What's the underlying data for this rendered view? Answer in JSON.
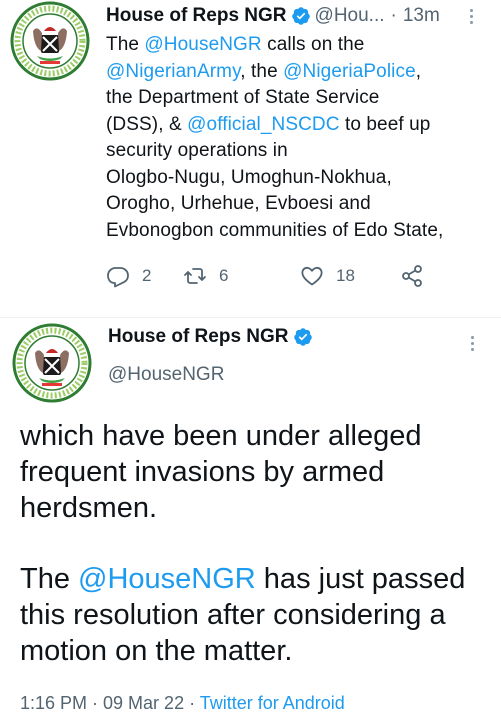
{
  "colors": {
    "accent": "#1d9bf0",
    "secondary_text": "#536471",
    "text": "#0f1419",
    "seal_green": "#2e7d32"
  },
  "tweet1": {
    "author_name": "House of Reps NGR",
    "handle": "@Hou...",
    "separator": "·",
    "time": "13m",
    "avatar_icon": "house-of-representatives-seal",
    "lines": [
      {
        "before": "The ",
        "mention": "@HouseNGR",
        "after": " calls on the"
      },
      {
        "before": "",
        "mention": "@NigerianArmy",
        "after": ", the ",
        "mention2": "@NigeriaPolice",
        "after2": ","
      },
      {
        "before": "the Department of State Service",
        "mention": "",
        "after": ""
      },
      {
        "before": "(DSS), & ",
        "mention": "@official_NSCDC",
        "after": " to beef up"
      },
      {
        "before": "security operations in",
        "mention": "",
        "after": ""
      },
      {
        "before": "Ologbo-Nugu, Umoghun-Nokhua,",
        "mention": "",
        "after": ""
      },
      {
        "before": "Orogho, Urhehue, Evboesi and",
        "mention": "",
        "after": ""
      },
      {
        "before": "Evbonogbon  communities of Edo State,",
        "mention": "",
        "after": ""
      }
    ],
    "actions": {
      "reply_count": "2",
      "retweet_count": "6",
      "like_count": "18"
    }
  },
  "tweet2": {
    "author_name": "House of Reps NGR",
    "handle": "@HouseNGR",
    "paragraph1": [
      "which have been under alleged",
      "frequent invasions by armed",
      "herdsmen."
    ],
    "paragraph2_line1_before": "The ",
    "paragraph2_line1_mention": "@HouseNGR",
    "paragraph2_line1_after": " has just passed",
    "paragraph2_rest": [
      "this resolution after considering a",
      "motion on the matter."
    ],
    "timestamp": "1:16 PM · 09 Mar 22 · ",
    "source": "Twitter for Android"
  }
}
